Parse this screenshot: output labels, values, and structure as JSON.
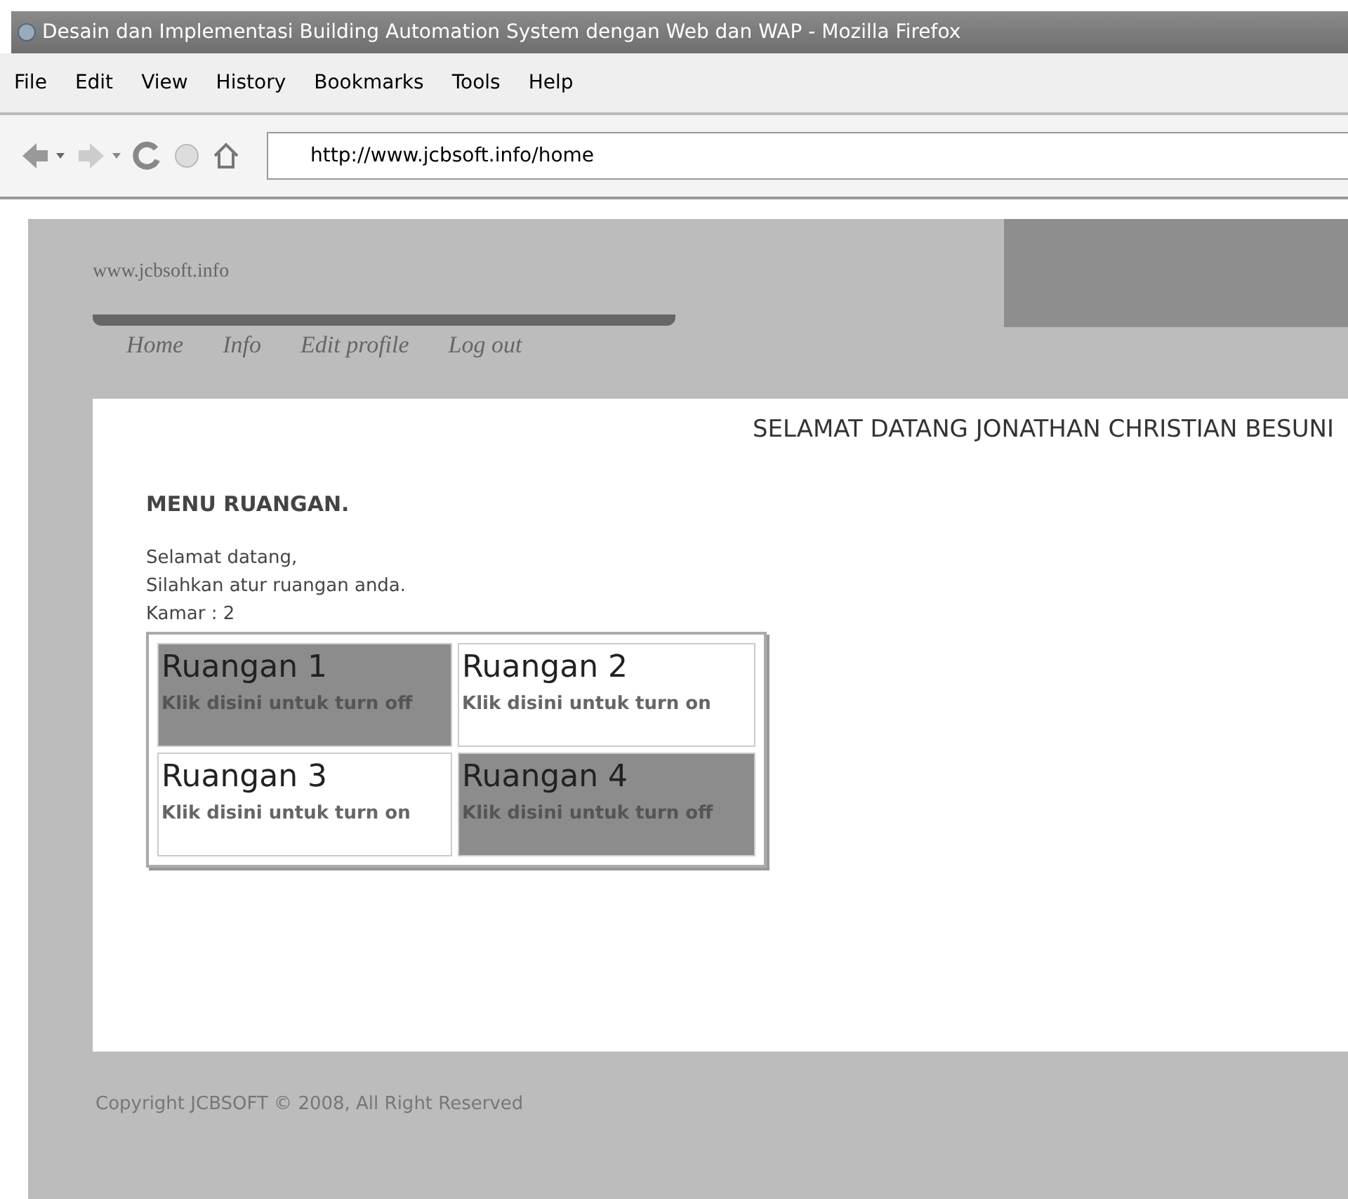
{
  "window": {
    "title": "Desain dan Implementasi Building Automation System dengan Web dan WAP - Mozilla Firefox"
  },
  "menu": [
    "File",
    "Edit",
    "View",
    "History",
    "Bookmarks",
    "Tools",
    "Help"
  ],
  "address": {
    "value": "http://www.jcbsoft.info/home"
  },
  "site": {
    "logo": "www.jcbsoft.info",
    "nav": [
      "Home",
      "Info",
      "Edit profile",
      "Log out"
    ]
  },
  "welcome": "SELAMAT DATANG JONATHAN CHRISTIAN BESUNI",
  "heading": "MENU RUANGAN.",
  "intro": [
    "Selamat datang,",
    "Silahkan atur ruangan anda.",
    "Kamar : 2"
  ],
  "rooms": [
    {
      "name": "Ruangan 1",
      "action": "Klik disini untuk turn off",
      "on": true
    },
    {
      "name": "Ruangan 2",
      "action": "Klik disini untuk turn on",
      "on": false
    },
    {
      "name": "Ruangan 3",
      "action": "Klik disini untuk turn on",
      "on": false
    },
    {
      "name": "Ruangan 4",
      "action": "Klik disini untuk turn off",
      "on": true
    }
  ],
  "footer": "Copyright JCBSOFT © 2008, All Right Reserved"
}
